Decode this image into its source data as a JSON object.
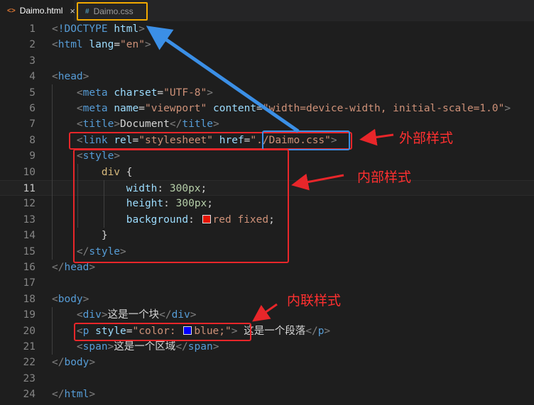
{
  "tabs": [
    {
      "icon": "<>",
      "label": "Daimo.html",
      "close": "×",
      "active": true
    },
    {
      "icon": "#",
      "label": "Daimo.css",
      "active": false
    }
  ],
  "lines": [
    {
      "n": "1",
      "tokens": [
        [
          "ang",
          "<"
        ],
        [
          "tag",
          "!DOCTYPE"
        ],
        [
          "txt",
          " "
        ],
        [
          "attr",
          "html"
        ],
        [
          "ang",
          ">"
        ]
      ]
    },
    {
      "n": "2",
      "tokens": [
        [
          "ang",
          "<"
        ],
        [
          "tag",
          "html"
        ],
        [
          "txt",
          " "
        ],
        [
          "attr",
          "lang"
        ],
        [
          "txt",
          "="
        ],
        [
          "str",
          "\"en\""
        ],
        [
          "ang",
          ">"
        ]
      ]
    },
    {
      "n": "3",
      "tokens": []
    },
    {
      "n": "4",
      "tokens": [
        [
          "ang",
          "<"
        ],
        [
          "tag",
          "head"
        ],
        [
          "ang",
          ">"
        ]
      ]
    },
    {
      "n": "5",
      "tokens": [
        [
          "txt",
          "    "
        ],
        [
          "ang",
          "<"
        ],
        [
          "tag",
          "meta"
        ],
        [
          "txt",
          " "
        ],
        [
          "attr",
          "charset"
        ],
        [
          "txt",
          "="
        ],
        [
          "str",
          "\"UTF-8\""
        ],
        [
          "ang",
          ">"
        ]
      ]
    },
    {
      "n": "6",
      "tokens": [
        [
          "txt",
          "    "
        ],
        [
          "ang",
          "<"
        ],
        [
          "tag",
          "meta"
        ],
        [
          "txt",
          " "
        ],
        [
          "attr",
          "name"
        ],
        [
          "txt",
          "="
        ],
        [
          "str",
          "\"viewport\""
        ],
        [
          "txt",
          " "
        ],
        [
          "attr",
          "content"
        ],
        [
          "txt",
          "="
        ],
        [
          "str",
          "\"width=device-width, initial-scale=1.0\""
        ],
        [
          "ang",
          ">"
        ]
      ]
    },
    {
      "n": "7",
      "tokens": [
        [
          "txt",
          "    "
        ],
        [
          "ang",
          "<"
        ],
        [
          "tag",
          "title"
        ],
        [
          "ang",
          ">"
        ],
        [
          "txt",
          "Document"
        ],
        [
          "ang",
          "</"
        ],
        [
          "tag",
          "title"
        ],
        [
          "ang",
          ">"
        ]
      ]
    },
    {
      "n": "8",
      "tokens": [
        [
          "txt",
          "    "
        ],
        [
          "ang",
          "<"
        ],
        [
          "tag",
          "link"
        ],
        [
          "txt",
          " "
        ],
        [
          "attr",
          "rel"
        ],
        [
          "txt",
          "="
        ],
        [
          "str",
          "\"stylesheet\""
        ],
        [
          "txt",
          " "
        ],
        [
          "attr",
          "href"
        ],
        [
          "txt",
          "="
        ],
        [
          "str",
          "\"./Daimo.css\""
        ],
        [
          "ang",
          ">"
        ]
      ]
    },
    {
      "n": "9",
      "tokens": [
        [
          "txt",
          "    "
        ],
        [
          "ang",
          "<"
        ],
        [
          "tag",
          "style"
        ],
        [
          "ang",
          ">"
        ]
      ]
    },
    {
      "n": "10",
      "tokens": [
        [
          "txt",
          "        "
        ],
        [
          "sel",
          "div"
        ],
        [
          "txt",
          " "
        ],
        [
          "brk",
          "{"
        ]
      ]
    },
    {
      "n": "11",
      "tokens": [
        [
          "txt",
          "            "
        ],
        [
          "prop",
          "width"
        ],
        [
          "txt",
          ": "
        ],
        [
          "num",
          "300px"
        ],
        [
          "txt",
          ";"
        ]
      ],
      "current": true
    },
    {
      "n": "12",
      "tokens": [
        [
          "txt",
          "            "
        ],
        [
          "prop",
          "height"
        ],
        [
          "txt",
          ": "
        ],
        [
          "num",
          "300px"
        ],
        [
          "txt",
          ";"
        ]
      ]
    },
    {
      "n": "13",
      "tokens": [
        [
          "txt",
          "            "
        ],
        [
          "prop",
          "background"
        ],
        [
          "txt",
          ": "
        ],
        [
          "swatch",
          "#e51400"
        ],
        [
          "val",
          "red fixed"
        ],
        [
          "txt",
          ";"
        ]
      ]
    },
    {
      "n": "14",
      "tokens": [
        [
          "txt",
          "        "
        ],
        [
          "brk",
          "}"
        ]
      ]
    },
    {
      "n": "15",
      "tokens": [
        [
          "txt",
          "    "
        ],
        [
          "ang",
          "</"
        ],
        [
          "tag",
          "style"
        ],
        [
          "ang",
          ">"
        ]
      ]
    },
    {
      "n": "16",
      "tokens": [
        [
          "ang",
          "</"
        ],
        [
          "tag",
          "head"
        ],
        [
          "ang",
          ">"
        ]
      ]
    },
    {
      "n": "17",
      "tokens": []
    },
    {
      "n": "18",
      "tokens": [
        [
          "ang",
          "<"
        ],
        [
          "tag",
          "body"
        ],
        [
          "ang",
          ">"
        ]
      ]
    },
    {
      "n": "19",
      "tokens": [
        [
          "txt",
          "    "
        ],
        [
          "ang",
          "<"
        ],
        [
          "tag",
          "div"
        ],
        [
          "ang",
          ">"
        ],
        [
          "txt",
          "这是一个块"
        ],
        [
          "ang",
          "</"
        ],
        [
          "tag",
          "div"
        ],
        [
          "ang",
          ">"
        ]
      ]
    },
    {
      "n": "20",
      "tokens": [
        [
          "txt",
          "    "
        ],
        [
          "ang",
          "<"
        ],
        [
          "tag",
          "p"
        ],
        [
          "txt",
          " "
        ],
        [
          "attr",
          "style"
        ],
        [
          "txt",
          "="
        ],
        [
          "str",
          "\"color: "
        ],
        [
          "swatch",
          "#0000ff"
        ],
        [
          "str",
          "blue;\""
        ],
        [
          "ang",
          ">"
        ],
        [
          "txt",
          " 这是一个段落"
        ],
        [
          "ang",
          "</"
        ],
        [
          "tag",
          "p"
        ],
        [
          "ang",
          ">"
        ]
      ]
    },
    {
      "n": "21",
      "tokens": [
        [
          "txt",
          "    "
        ],
        [
          "ang",
          "<"
        ],
        [
          "tag",
          "span"
        ],
        [
          "ang",
          ">"
        ],
        [
          "txt",
          "这是一个区域"
        ],
        [
          "ang",
          "</"
        ],
        [
          "tag",
          "span"
        ],
        [
          "ang",
          ">"
        ]
      ]
    },
    {
      "n": "22",
      "tokens": [
        [
          "ang",
          "</"
        ],
        [
          "tag",
          "body"
        ],
        [
          "ang",
          ">"
        ]
      ]
    },
    {
      "n": "23",
      "tokens": []
    },
    {
      "n": "24",
      "tokens": [
        [
          "ang",
          "</"
        ],
        [
          "tag",
          "html"
        ],
        [
          "ang",
          ">"
        ]
      ]
    }
  ],
  "annotations": {
    "external_style": "外部样式",
    "internal_style": "内部样式",
    "inline_style": "内联样式"
  },
  "colors": {
    "annotation_red": "#ff3030",
    "annotation_blue": "#3b8fe6",
    "tab_highlight": "#f2a900"
  }
}
